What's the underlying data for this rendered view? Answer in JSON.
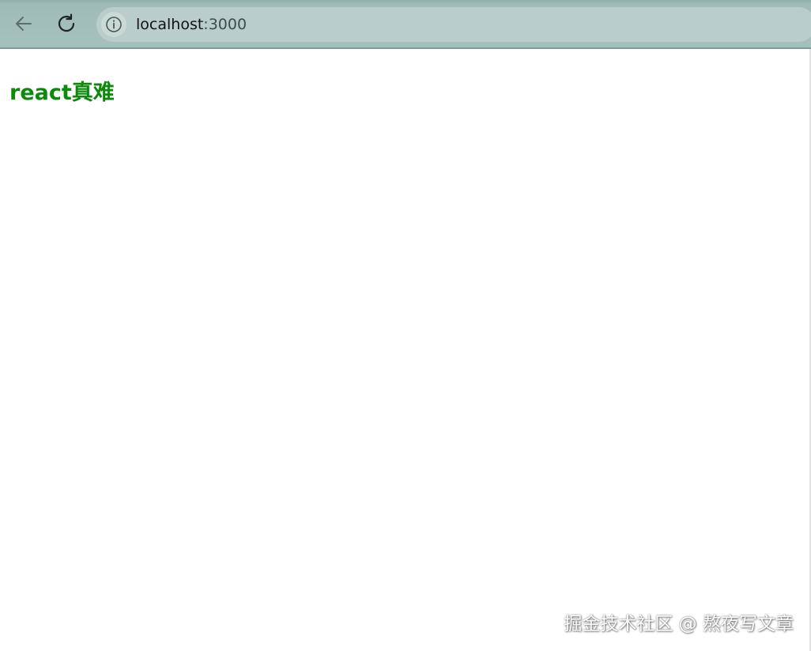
{
  "browser": {
    "url_host": "localhost",
    "url_port": ":3000",
    "icons": {
      "back": "arrow-left-icon",
      "reload": "reload-icon",
      "site_info": "info-icon"
    }
  },
  "page": {
    "heading": "react真难",
    "heading_color": "#0b8a0b"
  },
  "watermark": {
    "text": "掘金技术社区 @ 熬夜写文章"
  }
}
